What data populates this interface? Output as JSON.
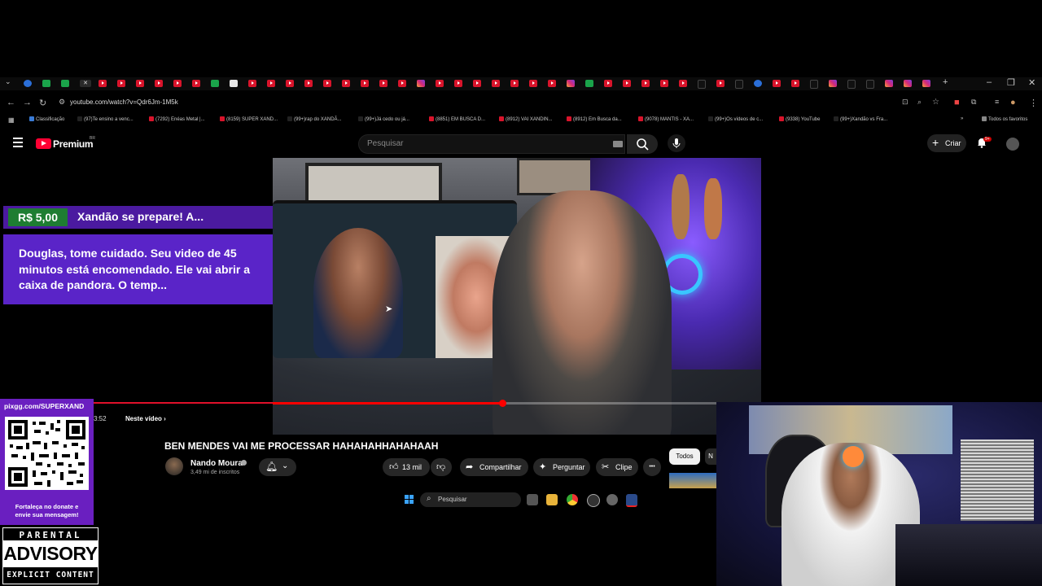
{
  "browser": {
    "tabs": [
      {
        "icon": "chevron-down-icon",
        "kind": "menu"
      },
      {
        "icon": "tab-favicon",
        "kind": "blue"
      },
      {
        "icon": "tab-favicon",
        "kind": "green"
      },
      {
        "icon": "tab-favicon",
        "kind": "green"
      },
      {
        "icon": "close-icon",
        "kind": "active"
      },
      {
        "icon": "youtube-icon",
        "kind": "yt"
      },
      {
        "icon": "youtube-icon",
        "kind": "yt"
      },
      {
        "icon": "youtube-icon",
        "kind": "yt"
      },
      {
        "icon": "youtube-icon",
        "kind": "yt"
      },
      {
        "icon": "youtube-icon",
        "kind": "yt"
      },
      {
        "icon": "youtube-icon",
        "kind": "yt"
      },
      {
        "icon": "tab-favicon",
        "kind": "green"
      },
      {
        "icon": "tab-favicon",
        "kind": "white"
      },
      {
        "icon": "youtube-icon",
        "kind": "yt"
      },
      {
        "icon": "youtube-icon",
        "kind": "yt"
      },
      {
        "icon": "youtube-icon",
        "kind": "yt"
      },
      {
        "icon": "youtube-icon",
        "kind": "yt"
      },
      {
        "icon": "youtube-icon",
        "kind": "yt"
      },
      {
        "icon": "youtube-icon",
        "kind": "yt"
      },
      {
        "icon": "youtube-icon",
        "kind": "yt"
      },
      {
        "icon": "youtube-icon",
        "kind": "yt"
      },
      {
        "icon": "youtube-icon",
        "kind": "yt"
      },
      {
        "icon": "instagram-icon",
        "kind": "ig"
      },
      {
        "icon": "youtube-icon",
        "kind": "yt"
      },
      {
        "icon": "youtube-icon",
        "kind": "yt"
      },
      {
        "icon": "youtube-icon",
        "kind": "yt"
      },
      {
        "icon": "youtube-icon",
        "kind": "yt"
      },
      {
        "icon": "youtube-icon",
        "kind": "yt"
      },
      {
        "icon": "youtube-icon",
        "kind": "yt"
      },
      {
        "icon": "youtube-icon",
        "kind": "yt"
      },
      {
        "icon": "instagram-icon",
        "kind": "ig"
      },
      {
        "icon": "tab-favicon",
        "kind": "green"
      },
      {
        "icon": "youtube-icon",
        "kind": "yt"
      },
      {
        "icon": "youtube-icon",
        "kind": "yt"
      },
      {
        "icon": "youtube-icon",
        "kind": "yt"
      },
      {
        "icon": "youtube-icon",
        "kind": "yt"
      },
      {
        "icon": "youtube-icon",
        "kind": "yt"
      },
      {
        "icon": "tiktok-icon",
        "kind": "tt"
      },
      {
        "icon": "youtube-icon",
        "kind": "yt"
      },
      {
        "icon": "tiktok-icon",
        "kind": "tt"
      },
      {
        "icon": "tab-favicon",
        "kind": "blue"
      },
      {
        "icon": "youtube-icon",
        "kind": "yt"
      },
      {
        "icon": "youtube-icon",
        "kind": "yt"
      },
      {
        "icon": "tiktok-icon",
        "kind": "tt"
      },
      {
        "icon": "instagram-icon",
        "kind": "ig"
      },
      {
        "icon": "tiktok-icon",
        "kind": "tt"
      },
      {
        "icon": "tiktok-icon",
        "kind": "tt"
      },
      {
        "icon": "instagram-icon",
        "kind": "ig"
      },
      {
        "icon": "instagram-icon",
        "kind": "ig"
      },
      {
        "icon": "instagram-icon",
        "kind": "ig"
      }
    ],
    "new_tab": "+",
    "window_controls": {
      "minimize": "–",
      "maximize": "❐",
      "close": "✕"
    },
    "url": "youtube.com/watch?v=Qdr6Jm-1M5k",
    "bookmarks": [
      "Classificação",
      "(97)Te ensino a venc...",
      "(7292) Enéas Metal |...",
      "(8159) SUPER XAND...",
      "(99+)rap do XANDÃ...",
      "(99+)Já cedo ou já...",
      "(8851) EM BUSCA D...",
      "(8912) VAI XANDIN...",
      "(8912) Em Busca da...",
      "(9078) MANTIS - XA...",
      "(99+)Os vídeos de c...",
      "(9338) YouTube",
      "(99+)Xandão vs Fra..."
    ],
    "all_bookmarks": "Todos os favoritos"
  },
  "youtube": {
    "brand": "Premium",
    "brand_region": "BR",
    "search_placeholder": "Pesquisar",
    "create_label": "Criar",
    "notif_badge": "9+",
    "progress_fraction": 0.47,
    "time": "3:52",
    "chapter": "Neste vídeo",
    "chapter_arrow": "›",
    "title": "BEN MENDES VAI ME PROCESSAR HAHAHAHHAHAHAAH",
    "channel": "Nando Moura",
    "subscribers": "3,49 mi de inscritos",
    "likes": "13 mil",
    "share": "Compartilhar",
    "ask": "Perguntar",
    "clip": "Clipe",
    "more": "•••",
    "chips": {
      "all": "Todos",
      "next": "N"
    }
  },
  "taskbar": {
    "search_placeholder": "Pesquisar"
  },
  "superchat": {
    "amount": "R$ 5,00",
    "title": "Xandão se prepare! A...",
    "message": "Douglas, tome cuidado. Seu video de 45 minutos está encomendado. Ele vai abrir a caixa de pandora. O temp..."
  },
  "donation": {
    "url": "pixgg.com/SUPERXAND",
    "caption_line1": "Fortaleça no donate e",
    "caption_line2": "envie sua mensagem!"
  },
  "advisory": {
    "top": "PARENTAL",
    "middle": "ADVISORY",
    "bottom": "EXPLICIT CONTENT"
  },
  "colors": {
    "youtube_red": "#ff0033",
    "superchat_purple": "#5a24c8",
    "superchat_green": "#1e7d32",
    "pix_purple": "#6a1fc0"
  }
}
